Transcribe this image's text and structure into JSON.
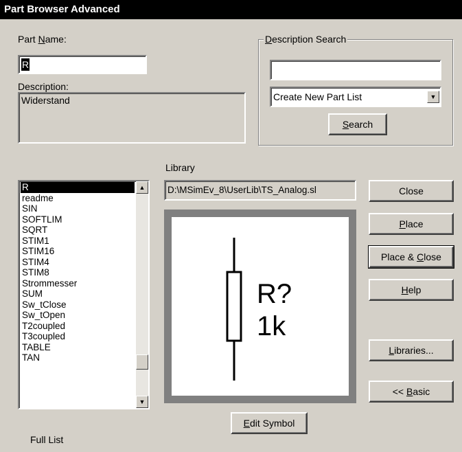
{
  "window": {
    "title": "Part Browser Advanced"
  },
  "part_name": {
    "label_pre": "Part ",
    "label_accel": "N",
    "label_post": "ame:",
    "value": "R"
  },
  "description": {
    "label": "Description:",
    "value": "Widerstand"
  },
  "desc_search": {
    "group_label_accel": "D",
    "group_label_rest": "escription Search",
    "input_value": "",
    "dropdown_value": "Create New Part List",
    "search_accel": "S",
    "search_rest": "earch"
  },
  "library": {
    "label": "Library",
    "path": "D:\\MSimEv_8\\UserLib\\TS_Analog.sl"
  },
  "parts_list": {
    "items": [
      "R",
      "readme",
      "SIN",
      "SOFTLIM",
      "SQRT",
      "STIM1",
      "STIM16",
      "STIM4",
      "STIM8",
      "Strommesser",
      "SUM",
      "Sw_tClose",
      "Sw_tOpen",
      "T2coupled",
      "T3coupled",
      "TABLE",
      "TAN"
    ],
    "selected_index": 0,
    "scroll_position": 0.86
  },
  "symbol": {
    "ref": "R?",
    "value": "1k"
  },
  "buttons": {
    "close": "Close",
    "place_accel": "P",
    "place_rest": "lace",
    "place_close_pre": "Place & ",
    "place_close_accel": "C",
    "place_close_rest": "lose",
    "help_accel": "H",
    "help_rest": "elp",
    "libraries_accel": "L",
    "libraries_rest": "ibraries...",
    "basic_pre": "<< ",
    "basic_accel": "B",
    "basic_rest": "asic",
    "edit_accel": "E",
    "edit_rest": "dit Symbol"
  },
  "footer": {
    "full_list": "Full List"
  },
  "icons": {
    "scroll_up": "arrow-up-icon",
    "scroll_down": "arrow-down-icon",
    "dropdown": "chevron-down-icon"
  }
}
